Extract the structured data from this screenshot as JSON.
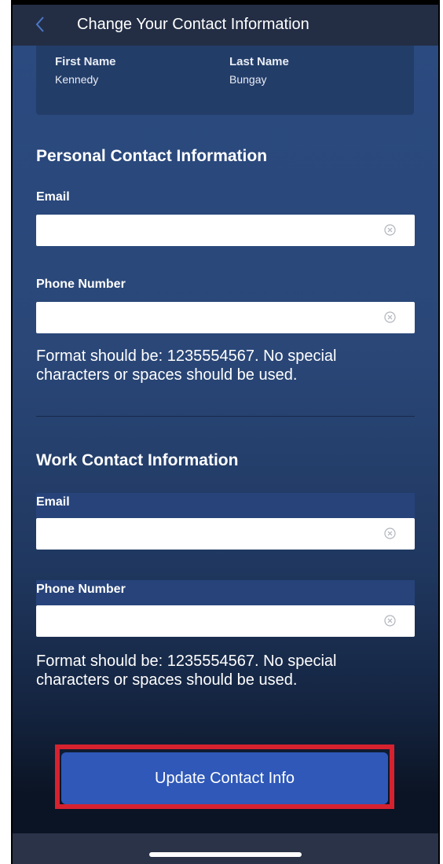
{
  "header": {
    "back_icon": "chevron-left-icon",
    "title": "Change Your Contact Information"
  },
  "name_card": {
    "first_name_label": "First Name",
    "first_name_value": "Kennedy",
    "last_name_label": "Last Name",
    "last_name_value": "Bungay"
  },
  "personal": {
    "title": "Personal Contact Information",
    "email_label": "Email",
    "email_value": "",
    "phone_label": "Phone Number",
    "phone_value": "",
    "hint": "Format should be: 1235554567. No special characters or spaces should be used."
  },
  "work": {
    "title": "Work Contact Information",
    "email_label": "Email",
    "email_value": "",
    "phone_label": "Phone Number",
    "phone_value": "",
    "hint": "Format should be: 1235554567. No special characters or spaces should be used."
  },
  "actions": {
    "update_label": "Update Contact Info"
  },
  "colors": {
    "accent": "#2f58b8",
    "highlight": "#d6222f",
    "header_bg": "#232e45"
  }
}
